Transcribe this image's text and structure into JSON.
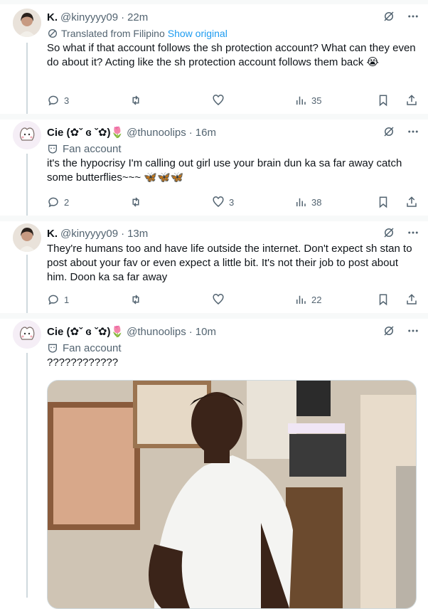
{
  "colors": {
    "accent": "#1d9bf0",
    "muted": "#536471",
    "line": "#cfd9de"
  },
  "tweets": [
    {
      "name": "K.",
      "handle": "@kinyyyy09",
      "time": "22m",
      "translated": "Translated from Filipino",
      "show_original": "Show original",
      "text": "So what if that account follows the sh protection account? What can they even do about it? Acting like the sh protection account follows them back 😭",
      "replies": "3",
      "retweets": "",
      "likes": "",
      "views": "35"
    },
    {
      "name": "Cie (✿ˇ ɞ ˇ✿)🌷",
      "handle": "@thunoolips",
      "time": "16m",
      "label": "Fan account",
      "text": "it's the hypocrisy I'm calling out girl use your brain dun ka sa far away catch some butterflies~~~ 🦋🦋🦋",
      "replies": "2",
      "retweets": "",
      "likes": "3",
      "views": "38"
    },
    {
      "name": "K.",
      "handle": "@kinyyyy09",
      "time": "13m",
      "text": "They're humans too and have life outside the internet. Don't expect sh stan to post about your fav or even expect a little bit. It's not their job to post about him. Doon ka sa far away",
      "replies": "1",
      "retweets": "",
      "likes": "",
      "views": "22"
    },
    {
      "name": "Cie (✿ˇ ɞ ˇ✿)🌷",
      "handle": "@thunoolips",
      "time": "10m",
      "label": "Fan account",
      "text": "????????????"
    }
  ],
  "icons": [
    "grok-icon",
    "more-icon",
    "translate-icon",
    "fan-account-icon",
    "reply-icon",
    "retweet-icon",
    "like-icon",
    "views-icon",
    "bookmark-icon",
    "share-icon"
  ]
}
